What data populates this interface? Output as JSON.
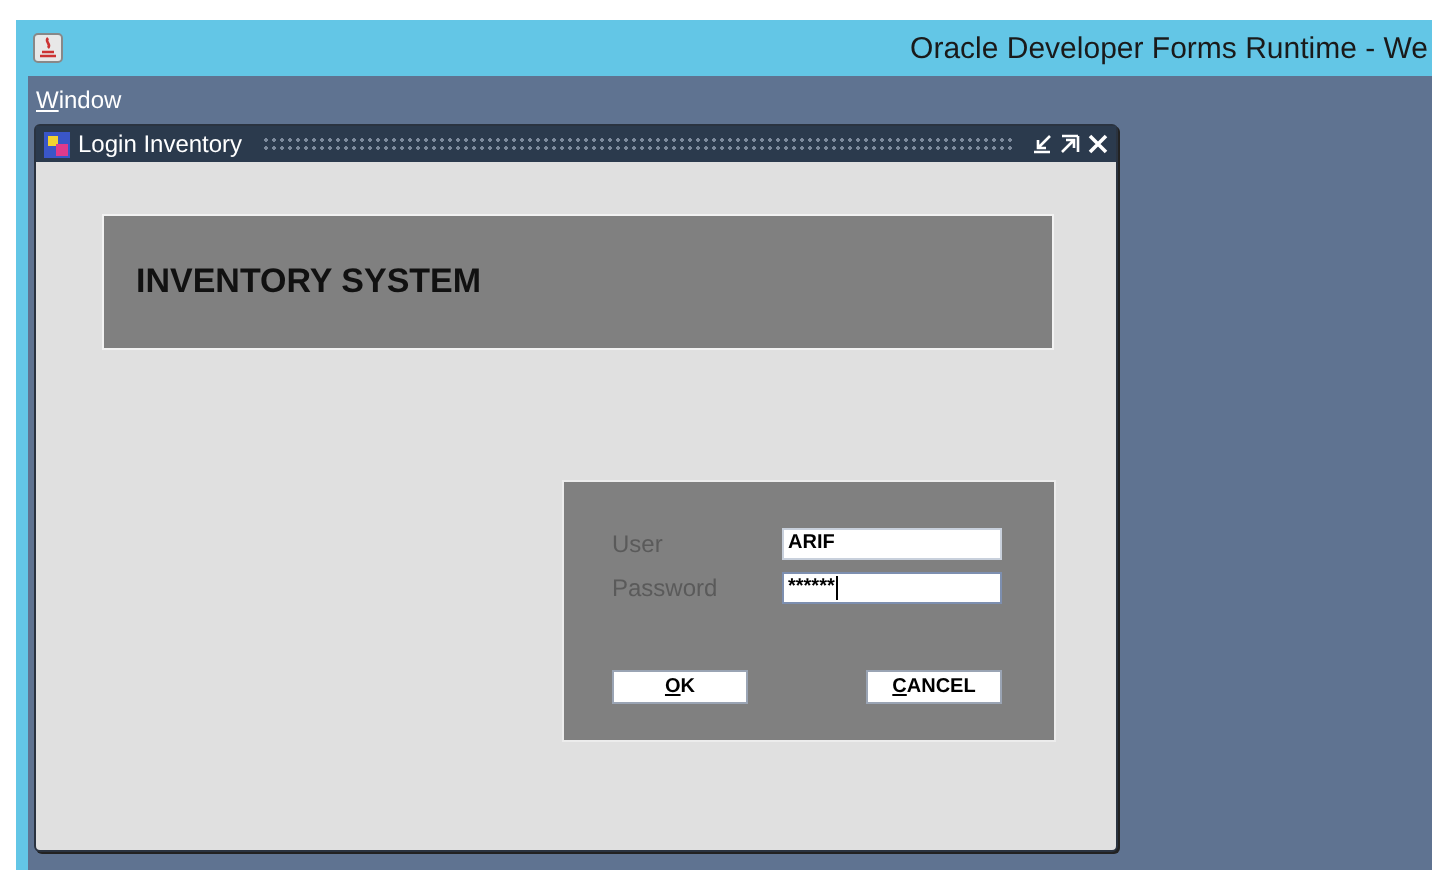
{
  "window": {
    "title": "Oracle Developer Forms Runtime - We"
  },
  "menu_bar": {
    "items": [
      {
        "label": "Window"
      }
    ]
  },
  "form_window": {
    "title": "Login Inventory"
  },
  "header": {
    "title": "INVENTORY SYSTEM"
  },
  "login": {
    "fields": [
      {
        "label": "User",
        "value": "ARIF",
        "focused": false
      },
      {
        "label": "Password",
        "value": "******",
        "focused": true
      }
    ],
    "buttons": [
      {
        "label": "OK"
      },
      {
        "label": "CANCEL"
      }
    ]
  }
}
